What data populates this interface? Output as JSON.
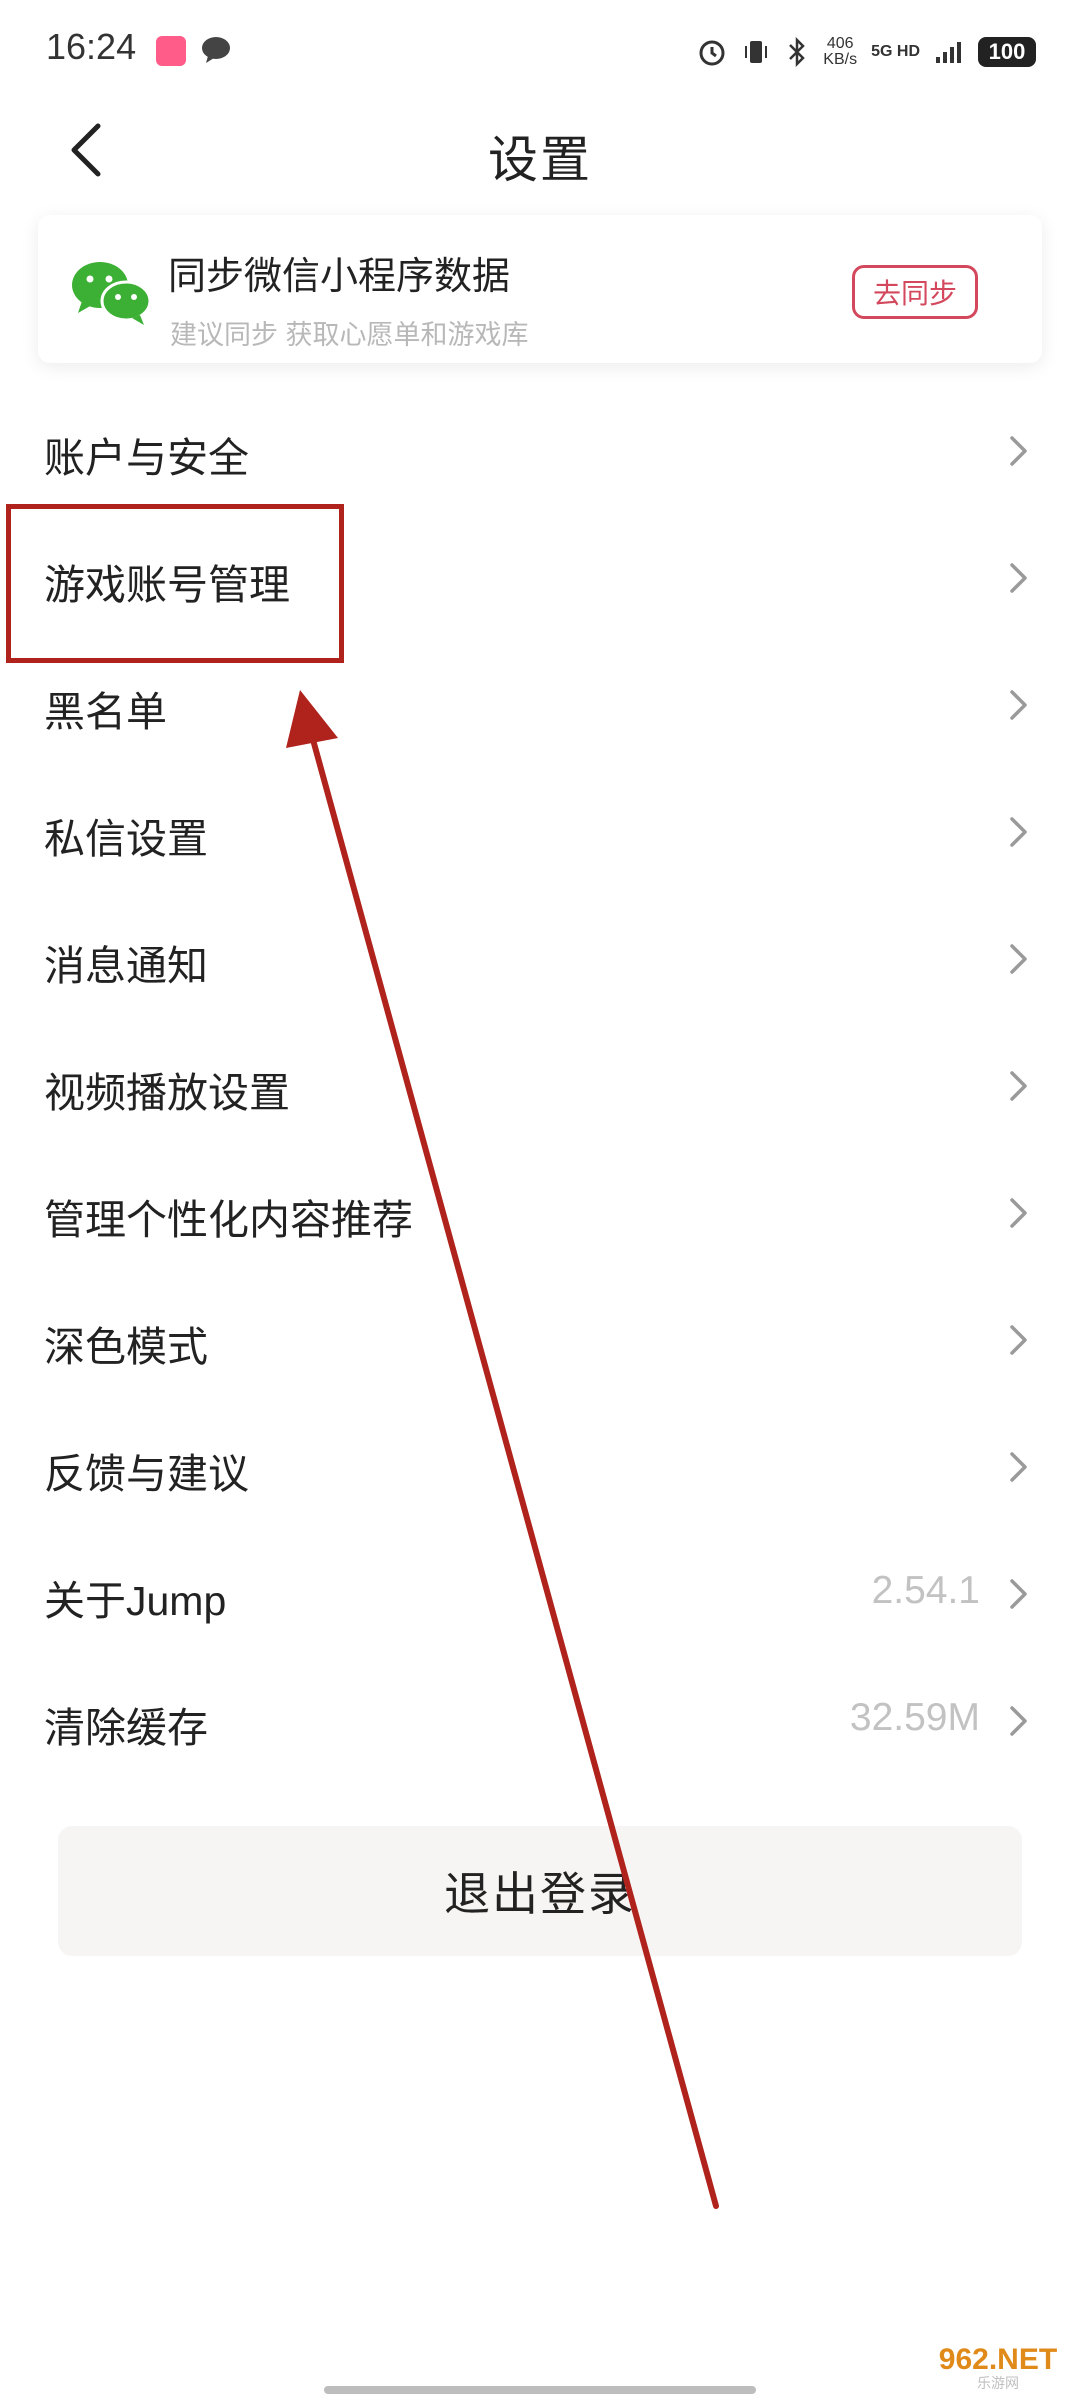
{
  "status_bar": {
    "time": "16:24",
    "speed_value": "406",
    "speed_unit": "KB/s",
    "network": "5G HD",
    "battery": "100"
  },
  "header": {
    "title": "设置"
  },
  "sync_card": {
    "title": "同步微信小程序数据",
    "subtitle": "建议同步 获取心愿单和游戏库",
    "button": "去同步"
  },
  "menu": {
    "items": [
      {
        "label": "账户与安全",
        "value": ""
      },
      {
        "label": "游戏账号管理",
        "value": ""
      },
      {
        "label": "黑名单",
        "value": ""
      },
      {
        "label": "私信设置",
        "value": ""
      },
      {
        "label": "消息通知",
        "value": ""
      },
      {
        "label": "视频播放设置",
        "value": ""
      },
      {
        "label": "管理个性化内容推荐",
        "value": ""
      },
      {
        "label": "深色模式",
        "value": ""
      },
      {
        "label": "反馈与建议",
        "value": ""
      },
      {
        "label": "关于Jump",
        "value": "2.54.1"
      },
      {
        "label": "清除缓存",
        "value": "32.59M"
      }
    ]
  },
  "logout": {
    "label": "退出登录"
  },
  "watermark": {
    "brand": "962.NET",
    "sub": "乐游网"
  },
  "colors": {
    "accent": "#d4485d",
    "annotation": "#b0231d",
    "wechat_green": "#3cb034"
  }
}
